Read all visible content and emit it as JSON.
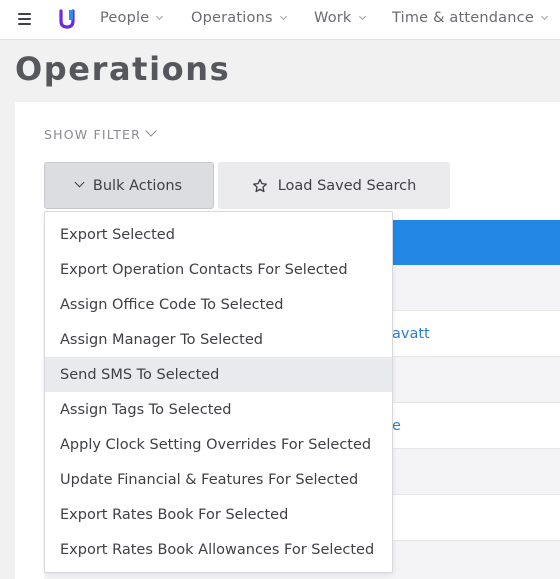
{
  "nav": {
    "items": [
      {
        "label": "People"
      },
      {
        "label": "Operations"
      },
      {
        "label": "Work"
      },
      {
        "label": "Time & attendance"
      }
    ]
  },
  "page": {
    "title": "Operations"
  },
  "filter": {
    "show_filter_label": "SHOW FILTER"
  },
  "toolbar": {
    "bulk_actions_label": "Bulk Actions",
    "load_saved_search_label": "Load Saved Search"
  },
  "table": {
    "visible_fragments": [
      "avatt",
      "e"
    ]
  },
  "bulk_menu": {
    "highlighted_index": 4,
    "items": [
      "Export Selected",
      "Export Operation Contacts For Selected",
      "Assign Office Code To Selected",
      "Assign Manager To Selected",
      "Send SMS To Selected",
      "Assign Tags To Selected",
      "Apply Clock Setting Overrides For Selected",
      "Update Financial & Features For Selected",
      "Export Rates Book For Selected",
      "Export Rates Book Allowances For Selected"
    ]
  },
  "colors": {
    "brand": "#6b2ae0",
    "table_header": "#2188e6",
    "link": "#2a7fd4"
  },
  "icons": [
    "menu-icon",
    "brand-logo-icon",
    "chevron-down-icon",
    "star-icon"
  ]
}
